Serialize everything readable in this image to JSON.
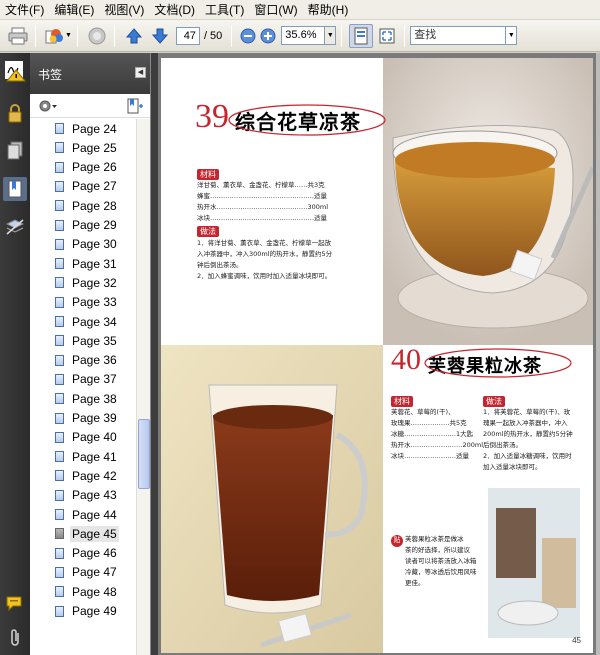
{
  "menu": [
    "文件(F)",
    "编辑(E)",
    "视图(V)",
    "文档(D)",
    "工具(T)",
    "窗口(W)",
    "帮助(H)"
  ],
  "toolbar": {
    "current_page": "47",
    "total_pages": "/ 50",
    "zoom": "35.6%",
    "find_placeholder": "查找"
  },
  "bookmarks": {
    "title": "书签",
    "items": [
      "Page 24",
      "Page 25",
      "Page 26",
      "Page 27",
      "Page 28",
      "Page 29",
      "Page 30",
      "Page 31",
      "Page 32",
      "Page 33",
      "Page 34",
      "Page 35",
      "Page 36",
      "Page 37",
      "Page 38",
      "Page 39",
      "Page 40",
      "Page 41",
      "Page 42",
      "Page 43",
      "Page 44",
      "Page 45",
      "Page 46",
      "Page 47",
      "Page 48",
      "Page 49"
    ],
    "selected": "Page 45"
  },
  "page": {
    "recipe1": {
      "number": "39",
      "title": "综合花草凉茶",
      "ing_label": "材料",
      "ingredients": [
        "洋甘菊、薰衣草、金盏花、柠檬草……共3克",
        "蜂蜜…………………………………………适量",
        "热开水……………………………………300ml",
        "冰块…………………………………………适量"
      ],
      "method_label": "做法",
      "steps": [
        "1．将洋甘菊、薰衣草、金盏花、柠檬草一起放",
        "入冲茶器中，冲入300ml的热开水，静置约5分",
        "钟后倒出茶汤。",
        "2．加入蜂蜜调味，饮用时加入适量冰块即可。"
      ]
    },
    "recipe2": {
      "number": "40",
      "title": "芙蓉果粒冰茶",
      "ing_label": "材料",
      "ingredients": [
        "芙蓉花、草莓的(干)、",
        "玫瑰果………………共5克",
        "冰糖……………………1大匙",
        "热开水……………………200ml",
        "冰块……………………适量"
      ],
      "method_label": "做法",
      "steps": [
        "1．将芙蓉花、草莓的(干)、玫",
        "瑰果一起放入冲茶器中，冲入",
        "200ml的热开水，静置约5分钟",
        "后倒出茶汤。",
        "2．加入适量冰糖调味，饮用时",
        "加入适量冰块即可。"
      ],
      "tip_label": "贴",
      "tip": [
        "芙蓉果粒冰茶是做冰",
        "茶的好选择，所以建议",
        "读者可以将茶汤放入冰箱",
        "冷藏，等冰透后饮用风味",
        "更佳。"
      ]
    },
    "page_number": "45"
  },
  "colors": {
    "accent_red": "#c4262f",
    "sidebar_dark": "#333333",
    "doc_bg": "#7a7a7a"
  }
}
